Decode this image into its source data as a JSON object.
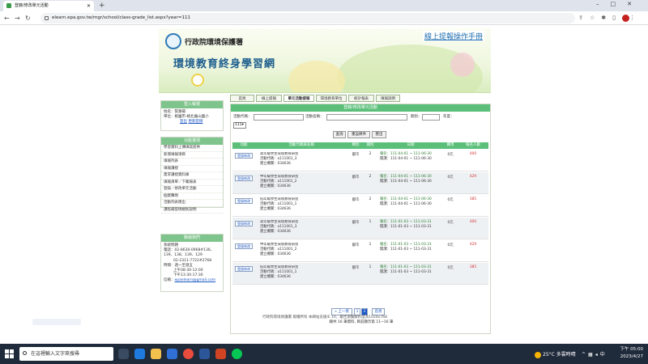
{
  "browser": {
    "tab_title": "登錄/修改單元活動",
    "url": "elearn.epa.gov.tw/mgr/school/class-grade_list.aspx?year=111"
  },
  "banner": {
    "agency": "行政院環境保護署",
    "site_title": "環境教育終身學習網",
    "manual_link": "線上提報操作手冊"
  },
  "nav_tabs": [
    "首頁",
    "線上提報",
    "單元活動提報",
    "環境教育單位",
    "統計報表",
    "填報說明"
  ],
  "login_box": {
    "title": "登入帳號",
    "name_label": "姓名：",
    "name_value": "張瀞揚",
    "unit_label": "單位：",
    "unit_value": "桃園市-桃北龜山國小",
    "logout": "登出",
    "change_pw": "更新密碼"
  },
  "func_box": {
    "title": "功能選項",
    "items": [
      "學習資料上傳填寫提供",
      "新增填報項目",
      "填報列表",
      "填報講授",
      "需求講授資料庫",
      "填報清單／下載報表",
      "登錄／修改單元活動",
      "個資聲明",
      "活動列表匯出",
      "課程補登碼規則說明"
    ]
  },
  "contact_box": {
    "title": "聯絡我們",
    "lines": [
      "系統問題",
      "電話：02-8630-0968#136、139、138、139、129",
      "02-2311-7722#2768",
      "時間：週一至週五",
      "上午08:30-12:00",
      "下午13:30-17:30",
      "信箱："
    ],
    "email": "epaelearn@gmail.com"
  },
  "main": {
    "title": "登錄/修改單元活動",
    "code_label": "活動代碼：",
    "name_label": "活動名稱：",
    "period_label": "期別：",
    "year_label": "年度：",
    "year_value": "111",
    "btn_search": "查詢",
    "btn_reset": "重設條件",
    "btn_export": "匯出",
    "columns": [
      "功能",
      "活動代碼與名稱",
      "類別",
      "期別",
      "日期",
      "費用",
      "報名人數"
    ],
    "rows": [
      {
        "action": "登錄修改",
        "name": "高年級學生環境教育研習",
        "code": "活動代碼：a111001_3",
        "unit": "建立機關：034636",
        "type": "都市",
        "period": "2",
        "signup": "報名：111-04-01 ~ 111-06-30",
        "open": "開課：111-04-01 ~ 111-06-30",
        "fee": "0元",
        "count": "400"
      },
      {
        "action": "登錄修改",
        "name": "中年級學生環境教育研習",
        "code": "活動代碼：a111001_2",
        "unit": "建立機關：034636",
        "type": "都市",
        "period": "2",
        "signup": "報名：111-04-01 ~ 111-06-30",
        "open": "開課：111-04-01 ~ 111-06-30",
        "fee": "0元",
        "count": "429"
      },
      {
        "action": "登錄修改",
        "name": "低年級學生環境教育研習",
        "code": "活動代碼：a111001_1",
        "unit": "建立機關：034636",
        "type": "都市",
        "period": "2",
        "signup": "報名：111-04-01 ~ 111-06-30",
        "open": "開課：111-04-01 ~ 111-06-30",
        "fee": "0元",
        "count": "385"
      },
      {
        "action": "登錄修改",
        "name": "高年級學生環境教育研習",
        "code": "活動代碼：a111001_3",
        "unit": "建立機關：034636",
        "type": "都市",
        "period": "1",
        "signup": "報名：111-01-03 ~ 111-03-31",
        "open": "開課：111-01-03 ~ 111-03-31",
        "fee": "0元",
        "count": "400"
      },
      {
        "action": "登錄修改",
        "name": "中年級學生環境教育研習",
        "code": "活動代碼：a111001_2",
        "unit": "建立機關：034636",
        "type": "都市",
        "period": "1",
        "signup": "報名：111-01-03 ~ 111-03-31",
        "open": "開課：111-01-03 ~ 111-03-31",
        "fee": "0元",
        "count": "429"
      },
      {
        "action": "登錄修改",
        "name": "低年級學生環境教育研習",
        "code": "活動代碼：a111001_1",
        "unit": "建立機關：034636",
        "type": "都市",
        "period": "1",
        "signup": "報名：111-01-03 ~ 111-03-31",
        "open": "開課：111-01-03 ~ 111-03-31",
        "fee": "0元",
        "count": "385"
      }
    ],
    "pager_prev": "« 上一頁",
    "pager_pages": [
      "1",
      "2"
    ],
    "pager_current": "2",
    "pager_next": "首頁",
    "summary": "總共 16 筆資料, 目前顯示第 11~16 筆"
  },
  "footer": "行政院環境保護署 版權所有 本網站支援IE 10，最佳瀏覽解析度為1024x768",
  "taskbar": {
    "search_placeholder": "在這裡輸入文字來搜尋",
    "weather": "25°C 多雲時晴",
    "time": "下午 05:00",
    "date": "2023/4/27"
  }
}
